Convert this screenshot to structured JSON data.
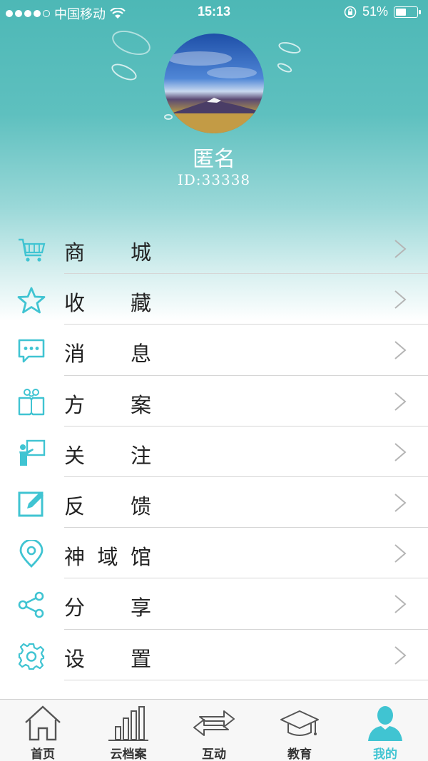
{
  "status_bar": {
    "carrier": "中国移动",
    "time": "15:13",
    "battery_percent": "51%",
    "battery_level": 0.51
  },
  "profile": {
    "name": "匿名",
    "id_text": "ID:33338"
  },
  "menu": {
    "items": [
      {
        "label_a": "商",
        "label_b": "",
        "label_c": "城",
        "icon": "cart-icon"
      },
      {
        "label_a": "收",
        "label_b": "",
        "label_c": "藏",
        "icon": "star-icon"
      },
      {
        "label_a": "消",
        "label_b": "",
        "label_c": "息",
        "icon": "message-icon"
      },
      {
        "label_a": "方",
        "label_b": "",
        "label_c": "案",
        "icon": "book-icon"
      },
      {
        "label_a": "关",
        "label_b": "",
        "label_c": "注",
        "icon": "teacher-board-icon"
      },
      {
        "label_a": "反",
        "label_b": "",
        "label_c": "馈",
        "icon": "edit-icon"
      },
      {
        "label_a": "神",
        "label_b": "域",
        "label_c": "馆",
        "icon": "location-pin-icon"
      },
      {
        "label_a": "分",
        "label_b": "",
        "label_c": "享",
        "icon": "share-icon"
      },
      {
        "label_a": "设",
        "label_b": "",
        "label_c": "置",
        "icon": "gear-icon"
      }
    ],
    "chevron": ">"
  },
  "tabbar": {
    "tabs": [
      {
        "label": "首页",
        "icon": "home-icon"
      },
      {
        "label": "云档案",
        "icon": "bar-chart-icon"
      },
      {
        "label": "互动",
        "icon": "exchange-arrows-icon"
      },
      {
        "label": "教育",
        "icon": "graduation-cap-icon"
      },
      {
        "label": "我的",
        "icon": "person-icon",
        "active": true
      }
    ]
  },
  "colors": {
    "accent": "#40c4d2",
    "header_teal": "#4db8b6"
  }
}
